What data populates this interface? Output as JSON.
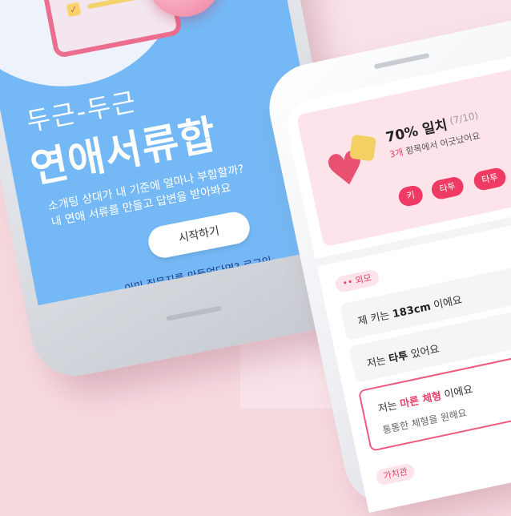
{
  "colors": {
    "brand_blue": "#74b9f5",
    "brand_pink": "#ef3b64",
    "background": "#f6d9df"
  },
  "landing": {
    "tagline": "두근-두근",
    "title": "연애서류합",
    "description_line1": "소개팅 상대가 내 기준에 얼마나 부합할까?",
    "description_line2": "내 연애 서류를 만들고 답변을 받아봐요",
    "start_button": "시작하기",
    "login_link": "이미 질문지를 만들었다면? 로그인",
    "icons": [
      "checklist-clipboard-icon",
      "heart-bubble-icon"
    ]
  },
  "result": {
    "match_title": "70% 일치",
    "match_count": "(7/10)",
    "match_desc_count": "3개",
    "match_desc_rest": " 항목에서 어긋났어요",
    "mismatch_chips": [
      "키",
      "타투",
      "타투"
    ],
    "section_appearance": "•• 외모",
    "answers": [
      {
        "prefix": "제 키는 ",
        "highlight": "183cm",
        "suffix": " 이에요"
      },
      {
        "prefix": "저는 ",
        "highlight": "타투",
        "suffix": " 있어요"
      }
    ],
    "selected_answer": {
      "prefix": "저는 ",
      "highlight": "마른 체형",
      "suffix": " 이에요",
      "wish": "통통한 체형을 원해요"
    },
    "section_next": "가치관"
  }
}
